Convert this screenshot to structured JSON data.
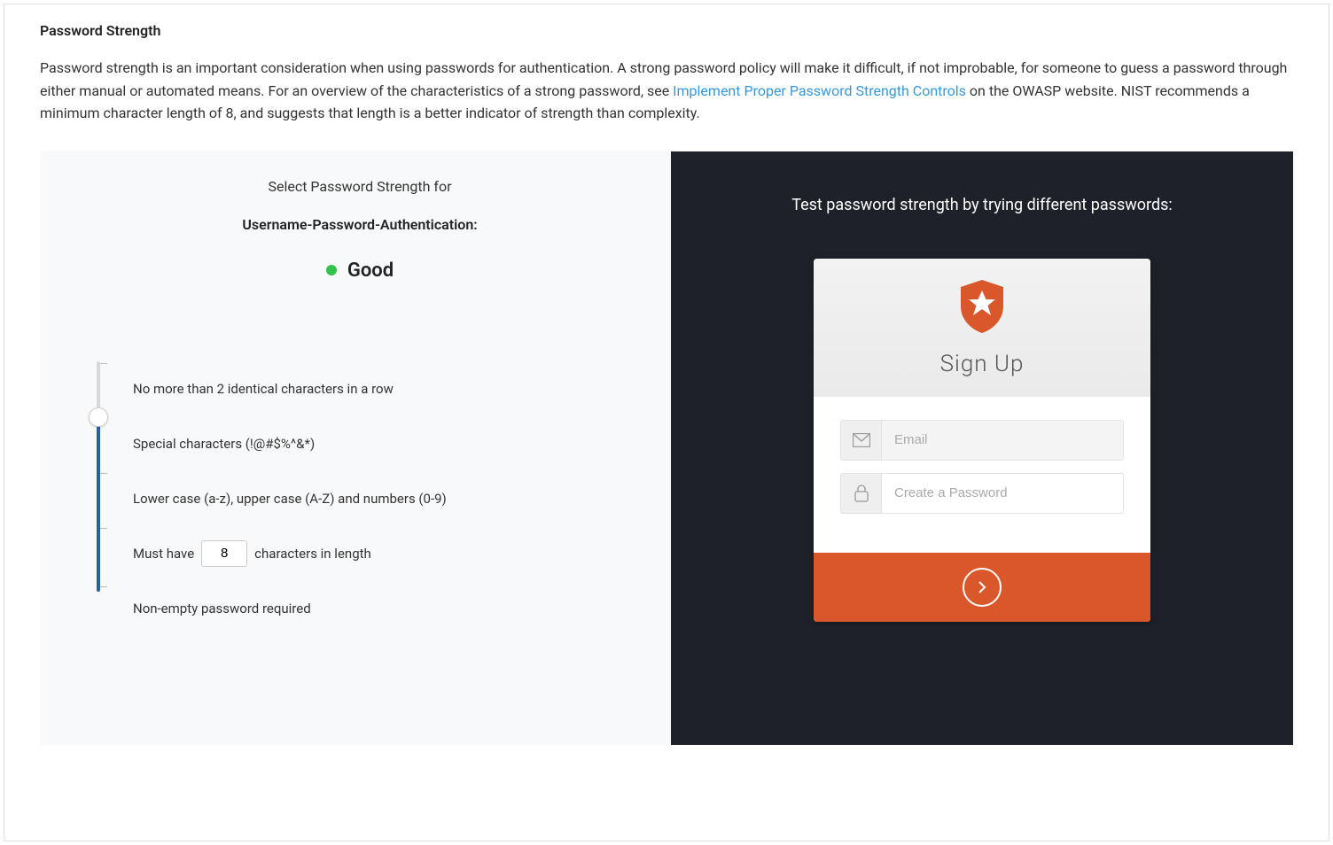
{
  "section": {
    "title": "Password Strength",
    "desc_part1": "Password strength is an important consideration when using passwords for authentication. A strong password policy will make it difficult, if not improbable, for someone to guess a password through either manual or automated means. For an overview of the characteristics of a strong password, see ",
    "link_text": "Implement Proper Password Strength Controls",
    "desc_part2": " on the OWASP website. NIST recommends a minimum character length of 8, and suggests that length is a better indicator of strength than complexity."
  },
  "left": {
    "select_title": "Select Password Strength for",
    "connection_name": "Username-Password-Authentication:",
    "strength_label": "Good",
    "strength_color": "#33c24d",
    "min_chars_value": "8",
    "rules": [
      "No more than 2 identical characters in a row",
      "Special characters (!@#$%^&*)",
      "Lower case (a-z), upper case (A-Z) and numbers (0-9)",
      "Must have",
      "characters in length",
      "Non-empty password required"
    ]
  },
  "right": {
    "title": "Test password strength by trying different passwords:",
    "signup_title": "Sign Up",
    "email_placeholder": "Email",
    "password_placeholder": "Create a Password"
  }
}
